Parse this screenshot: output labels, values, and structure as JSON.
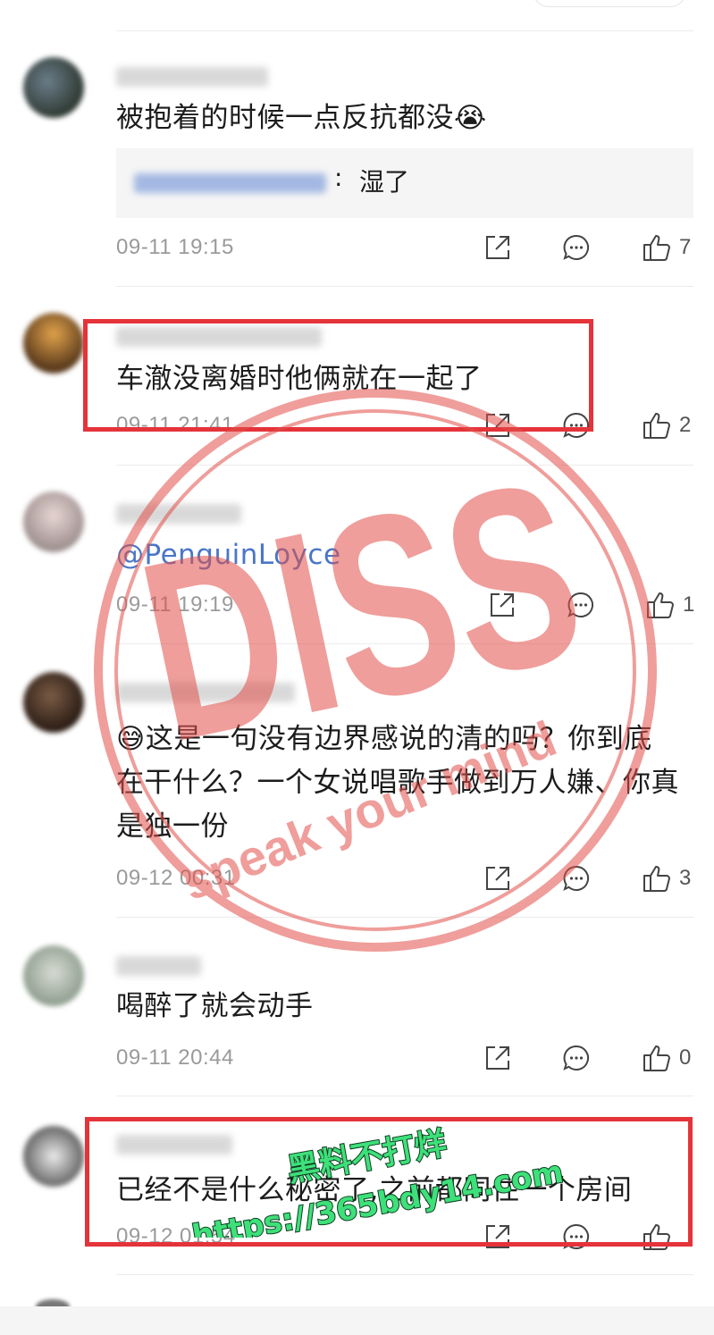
{
  "comments": [
    {
      "text": "被抱着的时候一点反抗都没😭",
      "reply": {
        "colon": ":",
        "text": "湿了"
      },
      "time": "09-11 19:15",
      "likes": "7"
    },
    {
      "text": "车澈没离婚时他俩就在一起了",
      "time": "09-11 21:41",
      "likes": "2"
    },
    {
      "text": "@PenguinLoyce",
      "time": "09-11 19:19",
      "likes": "1"
    },
    {
      "text": "😅这是一句没有边界感说的清的吗？你到底在干什么？一个女说唱歌手做到万人嫌、你真是独一份",
      "time": "09-12 00:31",
      "likes": "3"
    },
    {
      "text": "喝醉了就会动手",
      "time": "09-11 20:44",
      "likes": "0"
    },
    {
      "text": "已经不是什么秘密了,之前都同住一个房间",
      "time": "09-12 01:54",
      "likes": ""
    }
  ],
  "watermark": {
    "stamp_text": "DISS",
    "stamp_slogan": "speak your mind",
    "site_title": "黑料不打烊",
    "site_url": "https://365bdy14.com"
  },
  "icons": {
    "share": "share-icon",
    "comment": "comment-icon",
    "like": "thumbs-up-icon"
  },
  "colors": {
    "highlight_box": "#e5333a",
    "stamp": "#e2504a",
    "watermark_text": "#3ee07a",
    "mention": "#4a76c8",
    "timestamp": "#9a9a9a"
  }
}
